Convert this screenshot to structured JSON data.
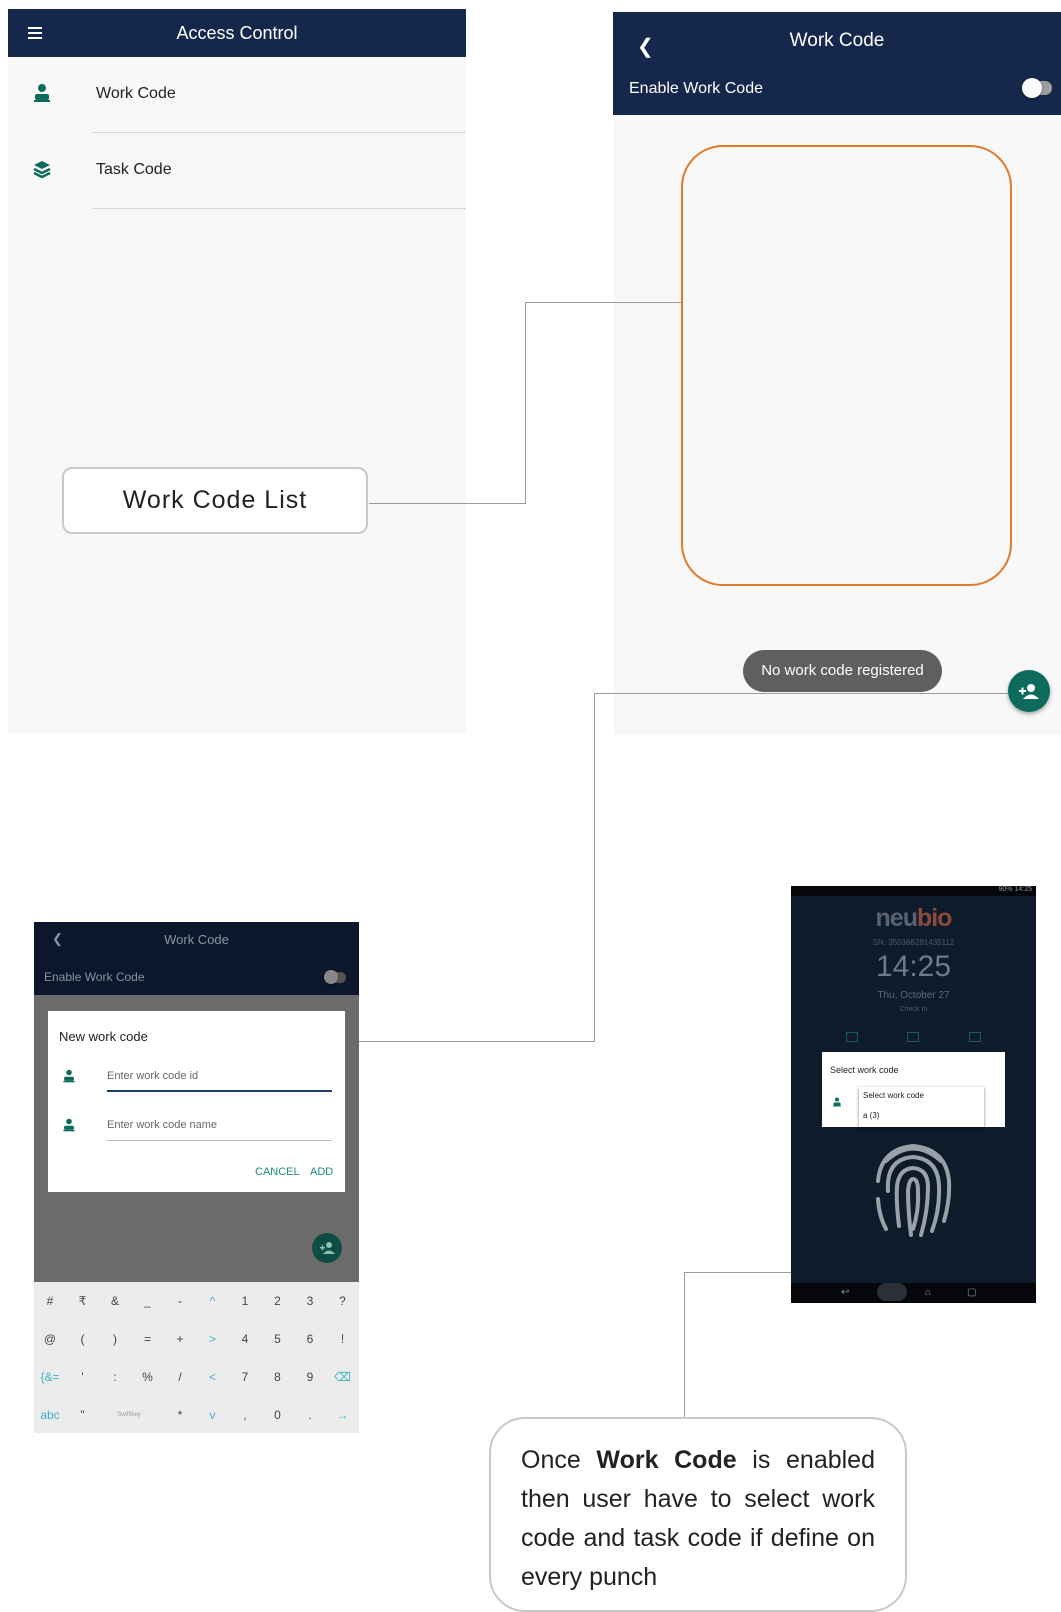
{
  "screen1": {
    "title": "Access Control",
    "menu_icon": "hamburger-menu-icon",
    "items": [
      {
        "label": "Work Code",
        "icon": "person-badge-icon"
      },
      {
        "label": "Task Code",
        "icon": "layers-icon"
      }
    ]
  },
  "screen2": {
    "title": "Work Code",
    "back_icon": "chevron-left-icon",
    "enable_label": "Enable Work Code",
    "empty_message": "No work code registered",
    "fab_icon": "add-person-icon"
  },
  "callouts": {
    "work_code_list": "Work Code List",
    "note_prefix": "Once ",
    "note_bold": "Work Code",
    "note_suffix": " is enabled then user have to select work code and task code if define on every punch"
  },
  "screen3": {
    "title": "Work Code",
    "enable_label": "Enable Work Code",
    "dialog_title": "New work code",
    "id_placeholder": "Enter work code id",
    "name_placeholder": "Enter work code name",
    "cancel_label": "CANCEL",
    "add_label": "ADD",
    "keyboard_rows": [
      [
        "#",
        "₹",
        "&",
        "_",
        "-",
        "^",
        "1",
        "2",
        "3",
        "?"
      ],
      [
        "@",
        "(",
        ")",
        "=",
        "+",
        ">",
        "4",
        "5",
        "6",
        "!"
      ],
      [
        "{&=",
        "'",
        ":",
        "%",
        "/",
        "<",
        "7",
        "8",
        "9",
        "⌫"
      ],
      [
        "abc",
        "\"",
        "",
        "",
        "*",
        "v",
        ",",
        "0",
        ".",
        "→"
      ]
    ],
    "swiftkey_label": "SwiftKey"
  },
  "screen4": {
    "status_right": "90% 14:25",
    "logo_a": "neu",
    "logo_b": "bio",
    "serial": "SN: 350368281435112",
    "time": "14:25",
    "date": "Thu, October 27",
    "check_label": "Check In",
    "dialog_title": "Select work code",
    "dropdown_title": "Select work code",
    "dropdown_option": "a (3)"
  }
}
